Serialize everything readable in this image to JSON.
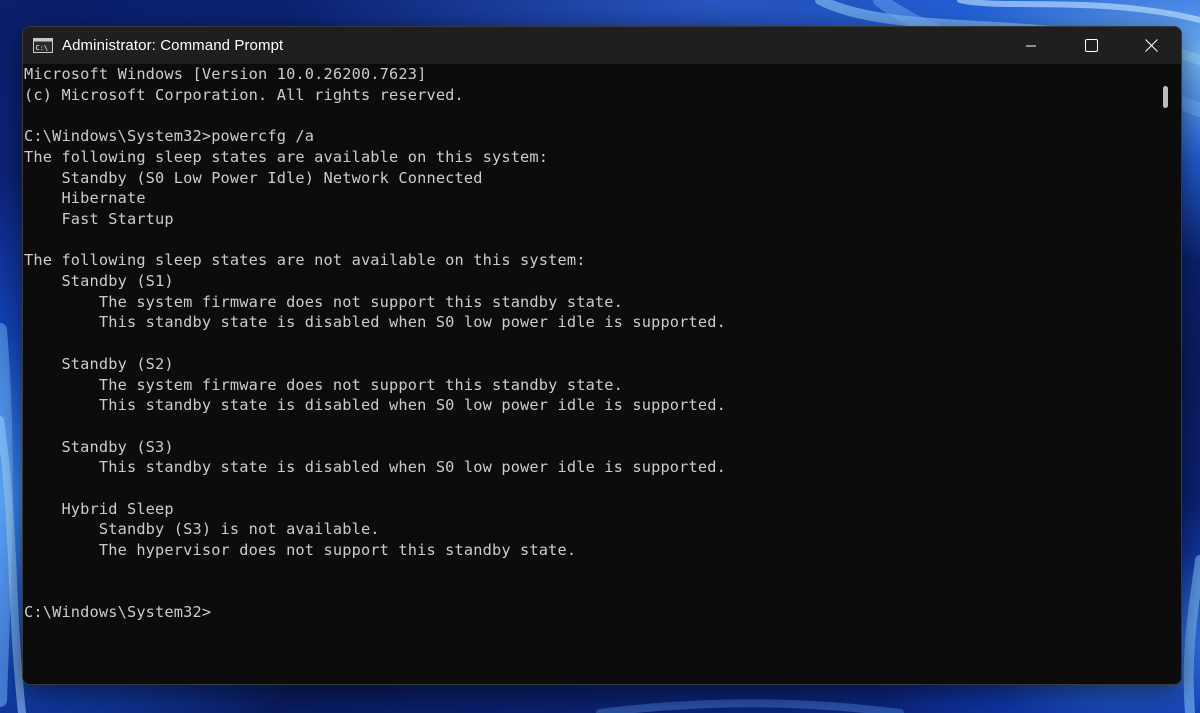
{
  "window": {
    "title": "Administrator: Command Prompt"
  },
  "icons": {
    "app": "cmd-icon",
    "minimize": "minimize-icon",
    "maximize": "maximize-icon",
    "close": "close-icon"
  },
  "colors": {
    "titlebar": "#1f1f1f",
    "console_bg": "#0c0c0c",
    "console_text": "#cccccc"
  },
  "console": {
    "lines": [
      "Microsoft Windows [Version 10.0.26200.7623]",
      "(c) Microsoft Corporation. All rights reserved.",
      "",
      "C:\\Windows\\System32>powercfg /a",
      "The following sleep states are available on this system:",
      "    Standby (S0 Low Power Idle) Network Connected",
      "    Hibernate",
      "    Fast Startup",
      "",
      "The following sleep states are not available on this system:",
      "    Standby (S1)",
      "        The system firmware does not support this standby state.",
      "        This standby state is disabled when S0 low power idle is supported.",
      "",
      "    Standby (S2)",
      "        The system firmware does not support this standby state.",
      "        This standby state is disabled when S0 low power idle is supported.",
      "",
      "    Standby (S3)",
      "        This standby state is disabled when S0 low power idle is supported.",
      "",
      "    Hybrid Sleep",
      "        Standby (S3) is not available.",
      "        The hypervisor does not support this standby state.",
      "",
      "",
      "C:\\Windows\\System32>"
    ]
  }
}
